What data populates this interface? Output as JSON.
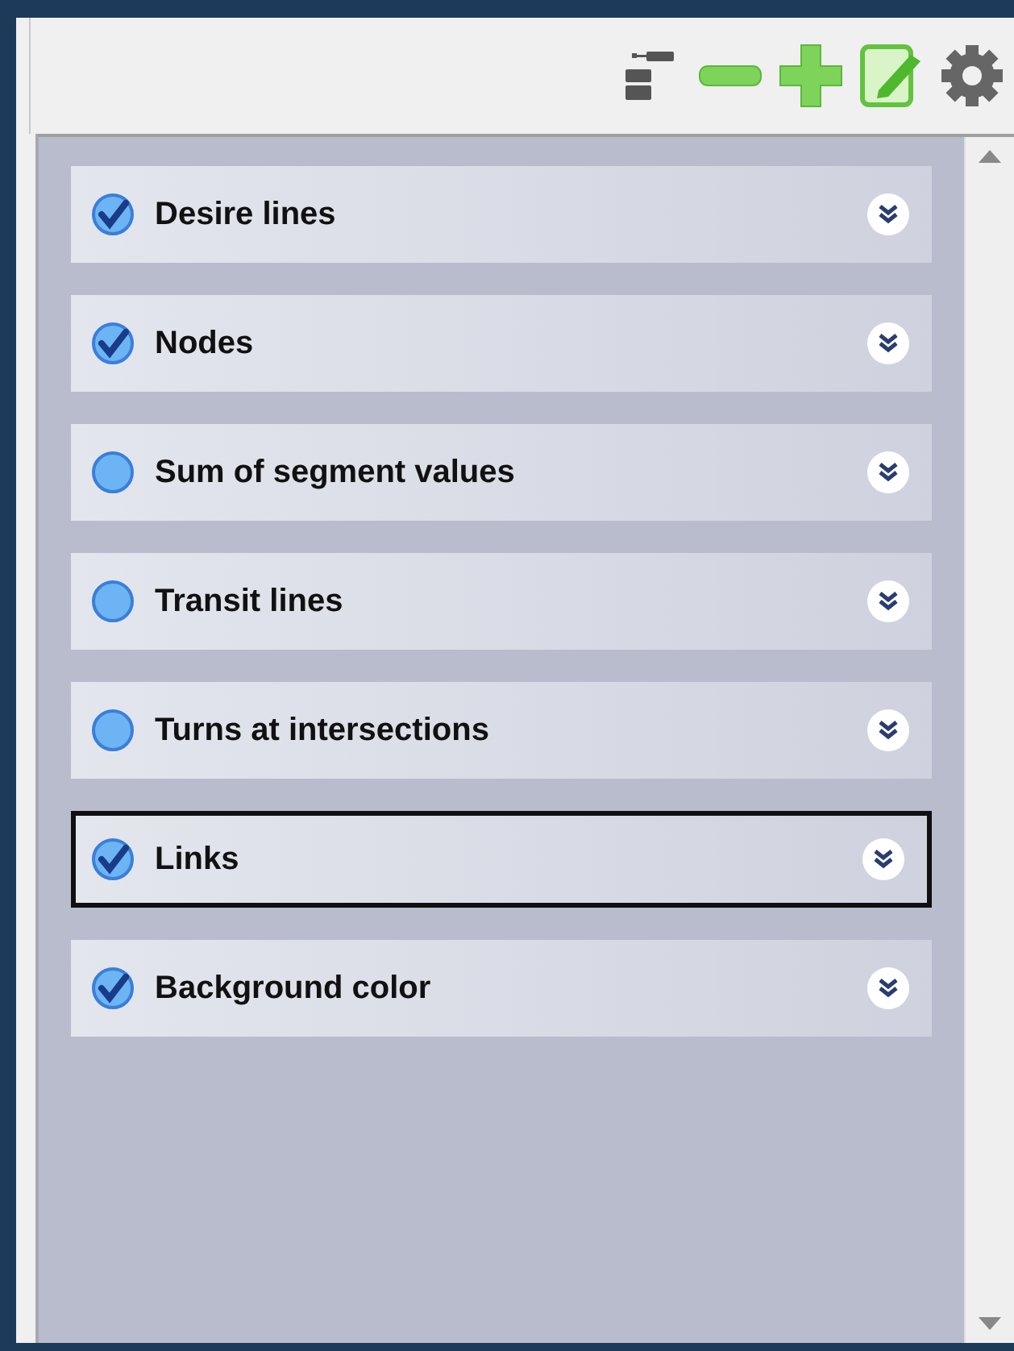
{
  "toolbar": {
    "buttons": [
      {
        "kind": "collapse"
      },
      {
        "kind": "remove"
      },
      {
        "kind": "add"
      },
      {
        "kind": "edit"
      },
      {
        "kind": "settings"
      }
    ]
  },
  "layers": [
    {
      "label": "Desire lines",
      "checked": true,
      "selected": false
    },
    {
      "label": "Nodes",
      "checked": true,
      "selected": false
    },
    {
      "label": "Sum of segment values",
      "checked": false,
      "selected": false
    },
    {
      "label": "Transit lines",
      "checked": false,
      "selected": false
    },
    {
      "label": "Turns at intersections",
      "checked": false,
      "selected": false
    },
    {
      "label": "Links",
      "checked": true,
      "selected": true
    },
    {
      "label": "Background color",
      "checked": true,
      "selected": false
    }
  ]
}
